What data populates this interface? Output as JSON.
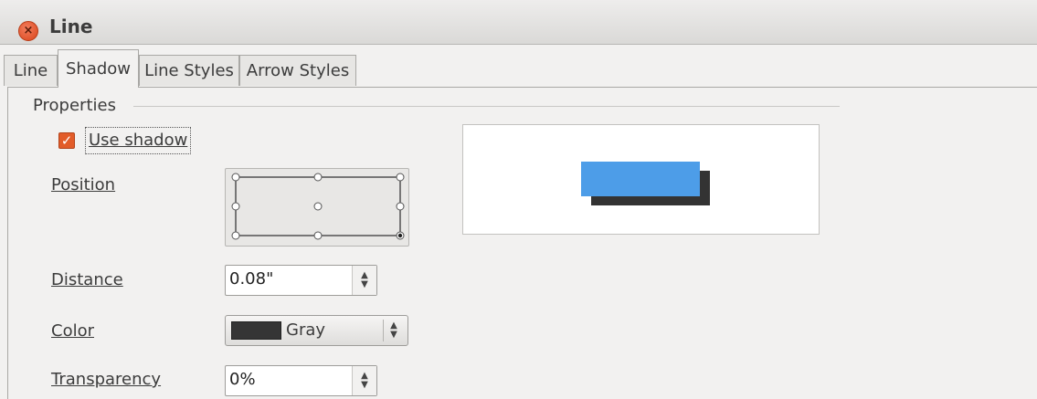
{
  "window": {
    "title": "Line",
    "close_icon": "close-icon"
  },
  "tabs": [
    {
      "label": "Line",
      "active": false
    },
    {
      "label": "Shadow",
      "active": true
    },
    {
      "label": "Line Styles",
      "active": false
    },
    {
      "label": "Arrow Styles",
      "active": false
    }
  ],
  "properties": {
    "section_label": "Properties",
    "use_shadow": {
      "label": "Use shadow",
      "checked": true
    },
    "position": {
      "label": "Position",
      "selected": "bottom-right"
    },
    "distance": {
      "label": "Distance",
      "value": "0.08\""
    },
    "color": {
      "label": "Color",
      "value": "Gray",
      "swatch": "#353535"
    },
    "transparency": {
      "label": "Transparency",
      "value": "0%"
    }
  },
  "preview": {
    "object_color": "#4d9de8",
    "shadow_color": "#333333"
  },
  "colors": {
    "accent": "#e25c29",
    "close": "#e0522a"
  }
}
